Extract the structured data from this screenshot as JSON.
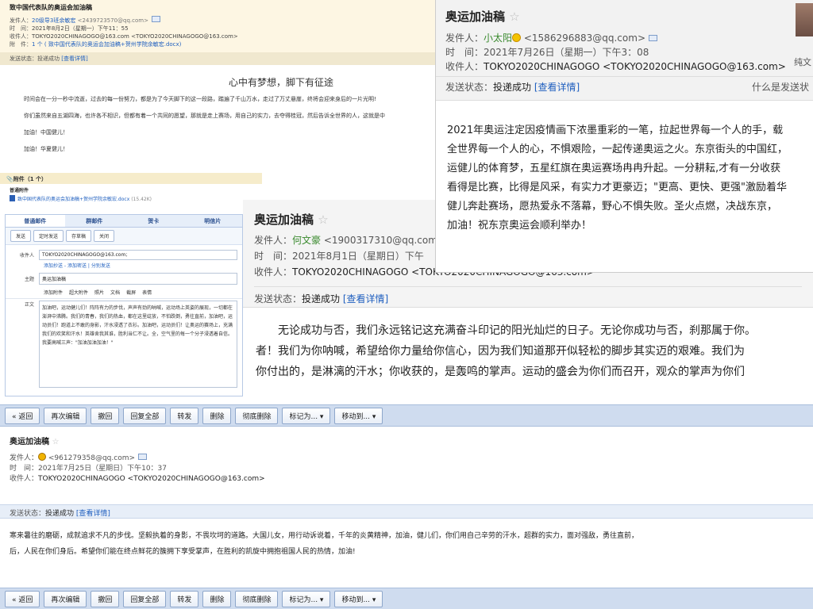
{
  "panelA": {
    "subject": "致中国代表队的奥运会加油稿",
    "from_label": "发件人：",
    "from_name": "20级导3班余敏宏",
    "from_addr": "<2439723570@qq.com>",
    "time_label": "时　间：",
    "time": "2021年8月2日（星期一）下午11：55",
    "to_label": "收件人：",
    "to": "TOKYO2020CHINAGOGO@163.com <TOKYO2020CHINAGOGO@163.com>",
    "attach_label": "附　件：",
    "attach": "1 个 ( 致中国代表队的奥运会加油稿+贺州学院余敏宏.docx)",
    "status_label": "发送状态：",
    "status": "投递成功",
    "detail": "[查看详情]",
    "slogan": "心中有梦想，脚下有征途",
    "body": [
      "时间会在一分一秒中流逝，过去的每一份努力，都是为了今天脚下的这一段路，踏遍了千山万水，走过了万丈悬崖，终将会迎来身后的一片光明!",
      "你们虽然来自五湖四海，也许各不相识，但都有着一个共同的愿望，那就是走上赛场，用自己的实力，去夺得桂冠，然后告诉全世界的人，这就是中",
      "加油！中国健儿！",
      "加油！华夏健儿！"
    ]
  },
  "attach_strip": {
    "bar": "附件（1 个）",
    "kind": "普通附件",
    "file": "致中国代表队的奥运会加油稿+贺州学院余敏宏.docx",
    "size": "(15.42K)"
  },
  "compose": {
    "tabs": [
      "普通邮件",
      "群邮件",
      "贺卡",
      "明信片"
    ],
    "buttons": [
      "发送",
      "定时发送",
      "存草稿",
      "关闭"
    ],
    "to_label": "收件人",
    "to_value": "TOKYO2020CHINAGOGO@163.com;",
    "links": "添加抄送 - 添加密送 | 分别发送",
    "subject_label": "主题",
    "subject_value": "奥运加油稿",
    "fmt": [
      "添加附件",
      "超大附件",
      "照片",
      "文档",
      "截屏",
      "表情"
    ],
    "body_label": "正文",
    "body_text": "加油吧，运动健儿们！阵阵有力的步伐，声声有劲的呐喊，运动场上英姿的展现，一切都在澎湃中沸腾。我们的青春，我们的热血，都在这里绽放，不怕跌倒，勇往直前，加油吧，运动员们！跑道上不敢的身影，汗水浸透了衣衫。加油吧，运动员们！让奥运的赛场上，充满我们的欢笑和汗水！英雄舍我其谁，胜利当仁不让。全，空气里的每一个分子浸透着自信。我要高喊三声：\"加油加油加油！\""
  },
  "panelD": {
    "subject": "奥运加油稿",
    "from_label": "发件人：",
    "from_name": "何文豪",
    "from_addr": "<1900317310@qq.com>",
    "time_label": "时　间：",
    "time": "2021年8月1日（星期日）下午",
    "to_label": "收件人：",
    "to": "TOKYO2020CHINAGOGO <TOKYO2020CHINAGOGO@163.com>",
    "status_label": "发送状态：",
    "status": "投递成功",
    "detail": "[查看详情]",
    "body": [
      "无论成功与否，我们永远铭记这充满奋斗印记的阳光灿烂的日子。无论你成功与否，刹那属于你。",
      "者！我们为你呐喊，希望给你力量给你信心，因为我们知道那开似轻松的脚步其实迈的艰难。我们为",
      "你付出的，是淋漓的汗水；你收获的，是轰鸣的掌声。运动的盛会为你们而召开，观众的掌声为你们"
    ]
  },
  "panelB": {
    "subject": "奥运加油稿",
    "from_label": "发件人：",
    "from_name": "小太阳",
    "from_addr": "<1586296883@qq.com>",
    "time_label": "时　间：",
    "time": "2021年7月26日（星期一）下午3：08",
    "to_label": "收件人：",
    "to": "TOKYO2020CHINAGOGO <TOKYO2020CHINAGOGO@163.com>",
    "plain": "纯文",
    "status_label": "发送状态：",
    "status": "投递成功",
    "detail": "[查看详情]",
    "right_note": "什么是发送状",
    "body": [
      "2021年奥运注定因疫情画下浓墨重彩的一笔，拉起世界每一个人的手，载",
      "全世界每一个人的心，不惧艰险，一起传递奥运之火。东京街头的中国红，",
      "运健儿的体育梦，五星红旗在奥运赛场冉冉升起。一分耕耘,才有一分收获",
      "看得是比赛，比得是风采，有实力才更豪迈；\"更高、更快、更强\"激励着华",
      "健儿奔赴赛场，愿热爱永不落幕，野心不惧失败。圣火点燃，决战东京，",
      "加油！祝东京奥运会顺利举办！"
    ]
  },
  "toolbar": {
    "buttons": [
      "« 返回",
      "再次编辑",
      "撤回",
      "回复全部",
      "转发",
      "删除",
      "彻底删除",
      "标记为... ▾",
      "移动到... ▾"
    ]
  },
  "panelE": {
    "subject": "奥运加油稿",
    "from_label": "发件人：",
    "from_addr": "<961279358@qq.com>",
    "time_label": "时　间：",
    "time": "2021年7月25日（星期日）下午10：37",
    "to_label": "收件人：",
    "to": "TOKYO2020CHINAGOGO <TOKYO2020CHINAGOGO@163.com>",
    "status_label": "发送状态：",
    "status": "投递成功",
    "detail": "[查看详情]",
    "body": [
      "寒来暑往的磨砺，成就追求不凡的步伐。坚毅执着的身影，不畏坎坷的道路。大国儿女，用行动诉说着，千年的炎黄精神，加油，健儿们，你们用自己辛劳的汗水，超群的实力，面对强敌，勇往直前，",
      "后，人民在你们身后。希望你们能在终点鲜花的簇拥下享受掌声，在胜利的凯旋中拥抱祖国人民的热情，加油!"
    ]
  }
}
